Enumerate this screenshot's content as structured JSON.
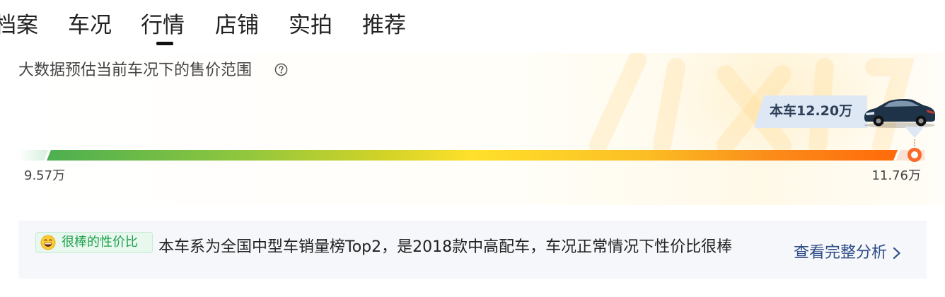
{
  "tabs": [
    {
      "label": "档案",
      "active": false
    },
    {
      "label": "车况",
      "active": false
    },
    {
      "label": "行情",
      "active": true
    },
    {
      "label": "店铺",
      "active": false
    },
    {
      "label": "实拍",
      "active": false
    },
    {
      "label": "推荐",
      "active": false
    }
  ],
  "price_range": {
    "title": "大数据预估当前车况下的售价范围",
    "help_icon": "question-circle-icon",
    "car_price_label": "本车12.20万",
    "car_price": 12.2,
    "min_label": "9.57万",
    "max_label": "11.76万",
    "min": 9.57,
    "max": 11.76,
    "bar_colors": [
      "#4caf50",
      "#ffe02b",
      "#ff6a0a"
    ],
    "marker_color": "#fa6a2a"
  },
  "analysis": {
    "badge_icon": "grinning-face-icon",
    "badge_label": "很棒的性价比",
    "summary": "本车系为全国中型车销量榜Top2，是2018款中高配车，车况正常情况下性价比很棒",
    "link_label": "查看完整分析",
    "link_icon": "chevron-right-icon",
    "accent_color": "#1fa14c",
    "link_color": "#2d4c86"
  }
}
